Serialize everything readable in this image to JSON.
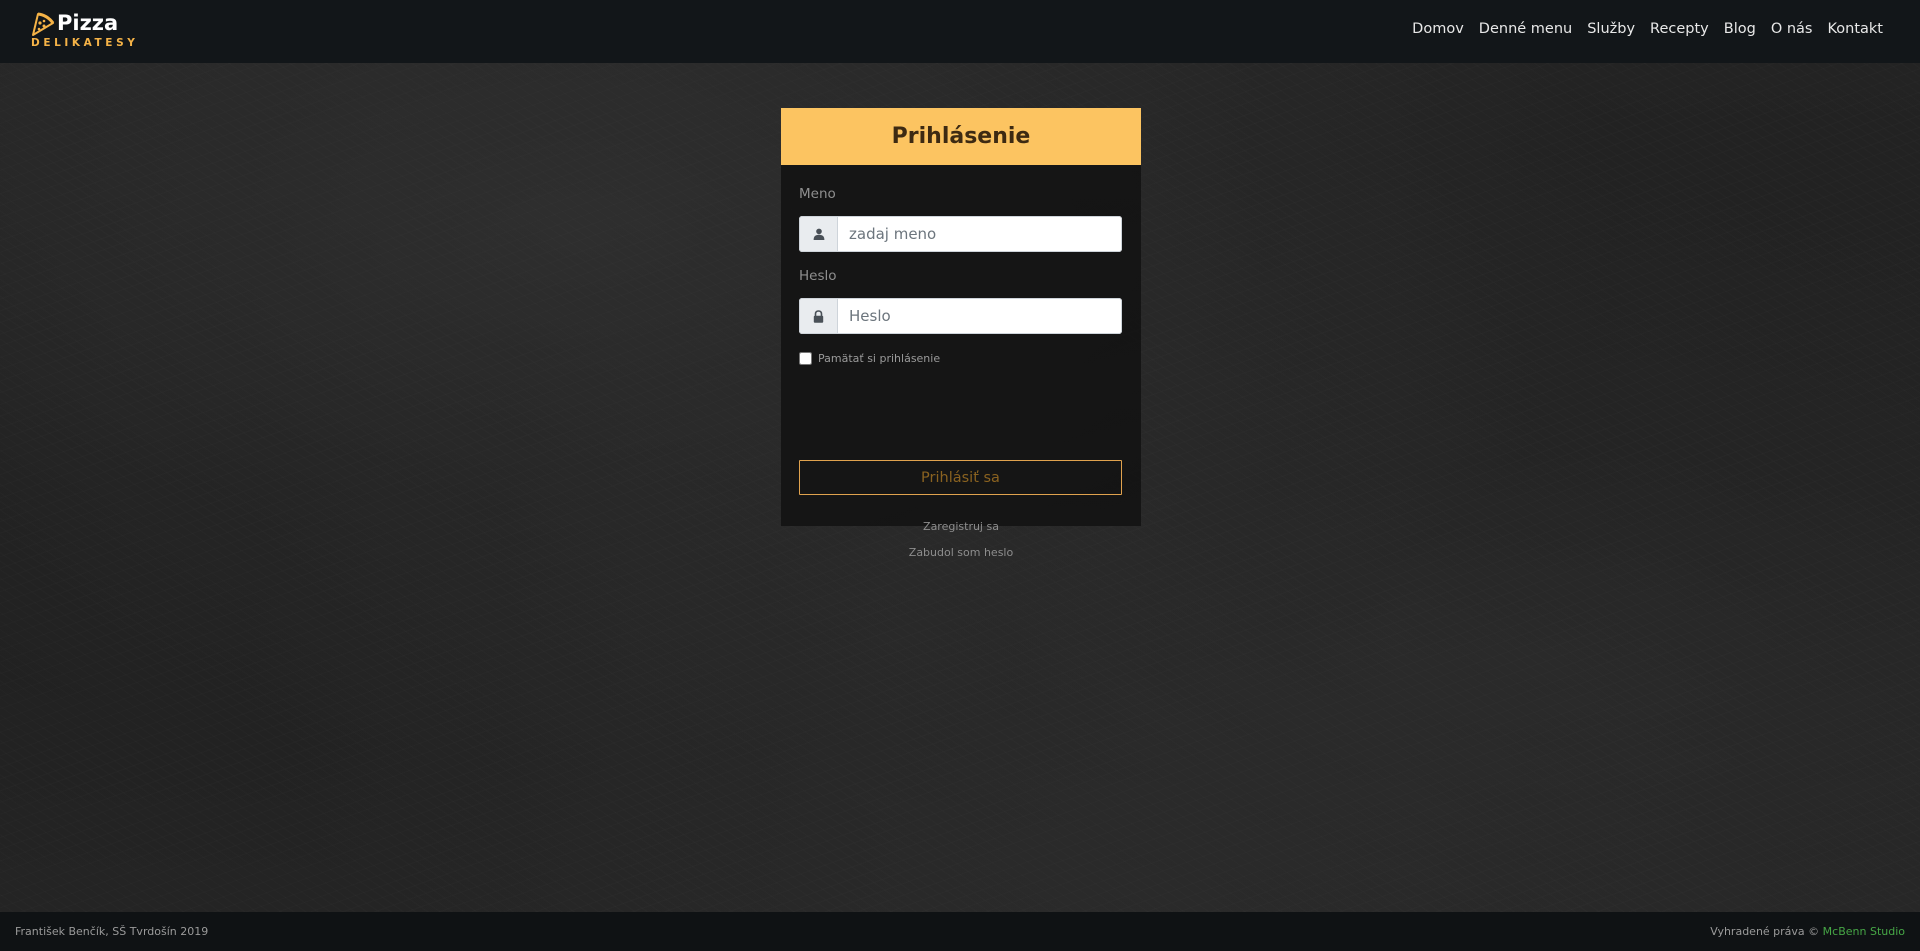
{
  "brand": {
    "name": "Pizza",
    "subtitle": "DELIKATESY",
    "accent_color": "#f5b347"
  },
  "nav": {
    "items": [
      {
        "label": "Domov"
      },
      {
        "label": "Denné menu"
      },
      {
        "label": "Služby"
      },
      {
        "label": "Recepty"
      },
      {
        "label": "Blog"
      },
      {
        "label": "O nás"
      },
      {
        "label": "Kontakt"
      }
    ]
  },
  "login": {
    "title": "Prihlásenie",
    "header_color": "#fcc461",
    "username": {
      "label": "Meno",
      "placeholder": "zadaj meno",
      "value": "",
      "icon": "user-icon"
    },
    "password": {
      "label": "Heslo",
      "placeholder": "Heslo",
      "value": "",
      "icon": "lock-icon"
    },
    "remember_label": "Pamätať si prihlásenie",
    "remember_checked": false,
    "submit_label": "Prihlásiť sa",
    "register_label": "Zaregistruj sa",
    "forgot_label": "Zabudol som heslo"
  },
  "footer": {
    "left_text": "František Benčík, SŠ Tvrdošín 2019",
    "rights_text": "Vyhradené práva © ",
    "studio_name": "McBenn Studio",
    "studio_color": "#46a646"
  }
}
